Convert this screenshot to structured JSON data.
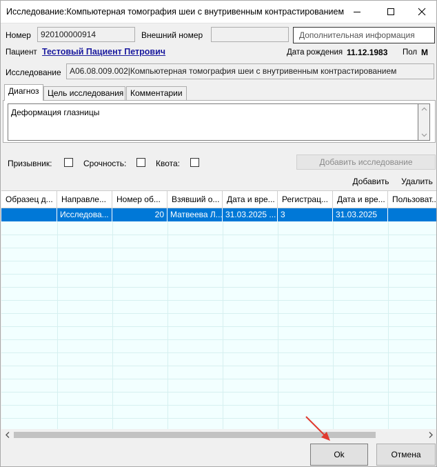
{
  "window": {
    "title": "Исследование:Компьютерная томография шеи с внутривенным контрастированием. ..."
  },
  "form": {
    "number_label": "Номер",
    "number_value": "920100000914",
    "external_number_label": "Внешний номер",
    "external_number_value": "",
    "additional_info_label": "Дополнительная информация",
    "patient_label": "Пациент",
    "patient_name": "Тестовый Пациент Петрович",
    "birthdate_label": "Дата рождения",
    "birthdate_value": "11.12.1983",
    "sex_label": "Пол",
    "sex_value": "М",
    "study_label": "Исследование",
    "study_value": "A06.08.009.002|Компьютерная томография шеи с внутривенным контрастированием"
  },
  "tabs": [
    {
      "label": "Диагноз",
      "active": true
    },
    {
      "label": "Цель исследования",
      "active": false
    },
    {
      "label": "Комментарии",
      "active": false
    }
  ],
  "diagnosis_text": "Деформация глазницы",
  "checks": {
    "conscript_label": "Призывник:",
    "urgency_label": "Срочность:",
    "quota_label": "Квота:"
  },
  "actions": {
    "add_study_label": "Добавить исследование",
    "add_label": "Добавить",
    "delete_label": "Удалить"
  },
  "table": {
    "columns": [
      "Образец д...",
      "Направле...",
      "Номер об...",
      "Взявший о...",
      "Дата и вре...",
      "Регистрац...",
      "Дата и вре...",
      "Пользоват..."
    ],
    "rows": [
      [
        "",
        "Исследова...",
        "20",
        "Матвеева Л...",
        "31.03.2025 ...",
        "3",
        "31.03.2025",
        ""
      ]
    ]
  },
  "footer": {
    "ok_label": "Ok",
    "cancel_label": "Отмена"
  },
  "colors": {
    "selection": "#0078d7",
    "grid_background": "#f2ffff",
    "annotation_arrow": "#e03a2f"
  }
}
